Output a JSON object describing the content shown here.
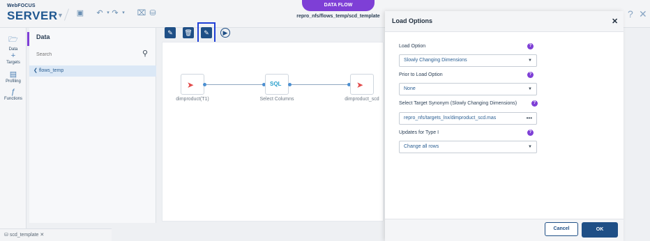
{
  "brand": {
    "top": "WebFOCUS",
    "bottom": "SERVER"
  },
  "header": {
    "tab_label": "DATA FLOW",
    "path": "repro_nfs/flows_temp/scd_template"
  },
  "leftnav": {
    "items": [
      {
        "label": "Data",
        "icon": "folder-icon"
      },
      {
        "label": "Targets",
        "icon": "plus-icon"
      },
      {
        "label": "Profiling",
        "icon": "chart-icon"
      },
      {
        "label": "Functions",
        "icon": "function-icon"
      }
    ]
  },
  "data_panel": {
    "title": "Data",
    "search_placeholder": "Search",
    "tree_item": "flows_temp"
  },
  "canvas": {
    "nodes": [
      {
        "label": "dimproduct(T1)"
      },
      {
        "label": "Select Columns",
        "badge": "SQL"
      },
      {
        "label": "dimproduct_scd"
      }
    ]
  },
  "bottom_tab": {
    "label": "scd_template"
  },
  "dialog": {
    "title": "Load Options",
    "fields": [
      {
        "label": "Load Option",
        "value": "Slowly Changing Dimensions"
      },
      {
        "label": "Prior to Load Option",
        "value": "None"
      },
      {
        "label": "Select Target Synonym (Slowly Changing Dimensions)",
        "value": "repro_nfs/targets_lnx/dimproduct_scd.mas"
      },
      {
        "label": "Updates for Type I",
        "value": "Change all rows"
      }
    ],
    "cancel_label": "Cancel",
    "ok_label": "OK"
  }
}
